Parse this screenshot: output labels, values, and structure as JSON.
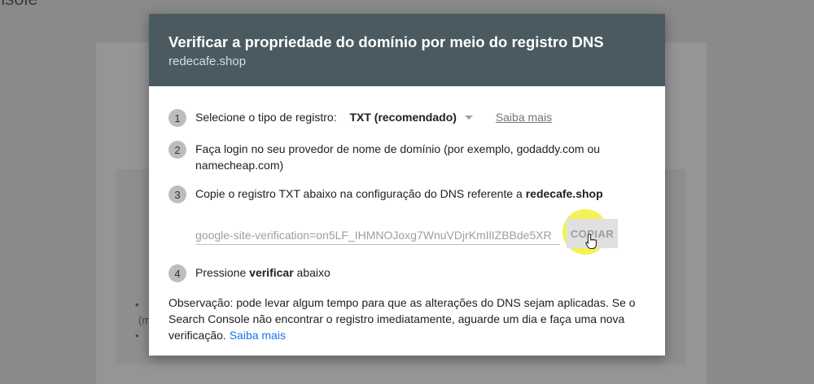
{
  "background": {
    "title_fragment": "nsole",
    "list_text_1": "•",
    "list_text_2": "(m",
    "list_text_3": "•"
  },
  "dialog": {
    "title": "Verificar a propriedade do domínio por meio do registro DNS",
    "subtitle": "redecafe.shop",
    "steps": [
      {
        "number": "1",
        "label": "Selecione o tipo de registro:",
        "select_value": "TXT (recomendado)",
        "link": "Saiba mais"
      },
      {
        "number": "2",
        "text": "Faça login no seu provedor de nome de domínio (por exemplo, godaddy.com ou namecheap.com)"
      },
      {
        "number": "3",
        "text_prefix": "Copie o registro TXT abaixo na configuração do DNS referente a ",
        "domain": "redecafe.shop",
        "record_value": "google-site-verification=on5LF_IHMNOJoxg7WnuVDjrKmIlIZBBde5XR",
        "copy_label": "COPIAR"
      },
      {
        "number": "4",
        "text_prefix": "Pressione ",
        "emphasis": "verificar",
        "text_suffix": " abaixo"
      }
    ],
    "note": {
      "text": "Observação: pode levar algum tempo para que as alterações do DNS sejam aplicadas. Se o Search Console não encontrar o registro imediatamente, aguarde um dia e faça uma nova verificação.",
      "link": "Saiba mais"
    }
  },
  "colors": {
    "header_bg": "#4a5a60",
    "link_blue": "#1a73e8",
    "highlight": "#eeee1e"
  }
}
